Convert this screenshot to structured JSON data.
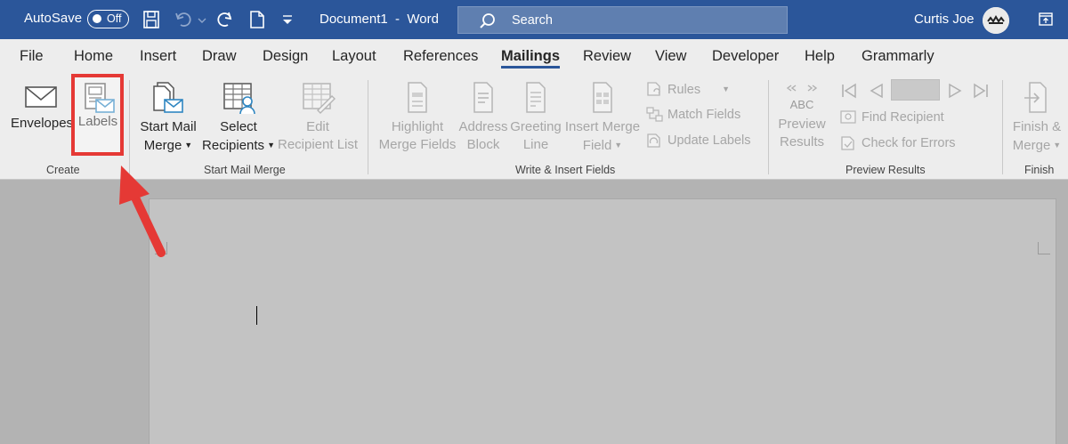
{
  "titlebar": {
    "autosave_label": "AutoSave",
    "autosave_state": "Off",
    "document_title": "Document1  -  Word",
    "search_placeholder": "Search",
    "user_name": "Curtis Joe"
  },
  "tabs": [
    {
      "label": "File"
    },
    {
      "label": "Home"
    },
    {
      "label": "Insert"
    },
    {
      "label": "Draw"
    },
    {
      "label": "Design"
    },
    {
      "label": "Layout"
    },
    {
      "label": "References"
    },
    {
      "label": "Mailings",
      "active": true
    },
    {
      "label": "Review"
    },
    {
      "label": "View"
    },
    {
      "label": "Developer"
    },
    {
      "label": "Help"
    },
    {
      "label": "Grammarly"
    }
  ],
  "ribbon": {
    "create": {
      "group_label": "Create",
      "envelopes": "Envelopes",
      "labels": "Labels"
    },
    "start_mail_merge": {
      "group_label": "Start Mail Merge",
      "start_line1": "Start Mail",
      "start_line2": "Merge",
      "select_line1": "Select",
      "select_line2": "Recipients",
      "edit_line1": "Edit",
      "edit_line2": "Recipient List"
    },
    "write_insert": {
      "group_label": "Write & Insert Fields",
      "highlight_line1": "Highlight",
      "highlight_line2": "Merge Fields",
      "address_line1": "Address",
      "address_line2": "Block",
      "greeting_line1": "Greeting",
      "greeting_line2": "Line",
      "insert_line1": "Insert Merge",
      "insert_line2": "Field",
      "rules": "Rules",
      "match_fields": "Match Fields",
      "update_labels": "Update Labels"
    },
    "preview": {
      "group_label": "Preview Results",
      "abc": "ABC",
      "preview_line1": "Preview",
      "preview_line2": "Results",
      "find_recipient": "Find Recipient",
      "check_errors": "Check for Errors"
    },
    "finish": {
      "group_label": "Finish",
      "finish_line1": "Finish &",
      "finish_line2": "Merge"
    }
  },
  "colors": {
    "titlebar": "#2b569a",
    "highlight": "#e53935"
  }
}
